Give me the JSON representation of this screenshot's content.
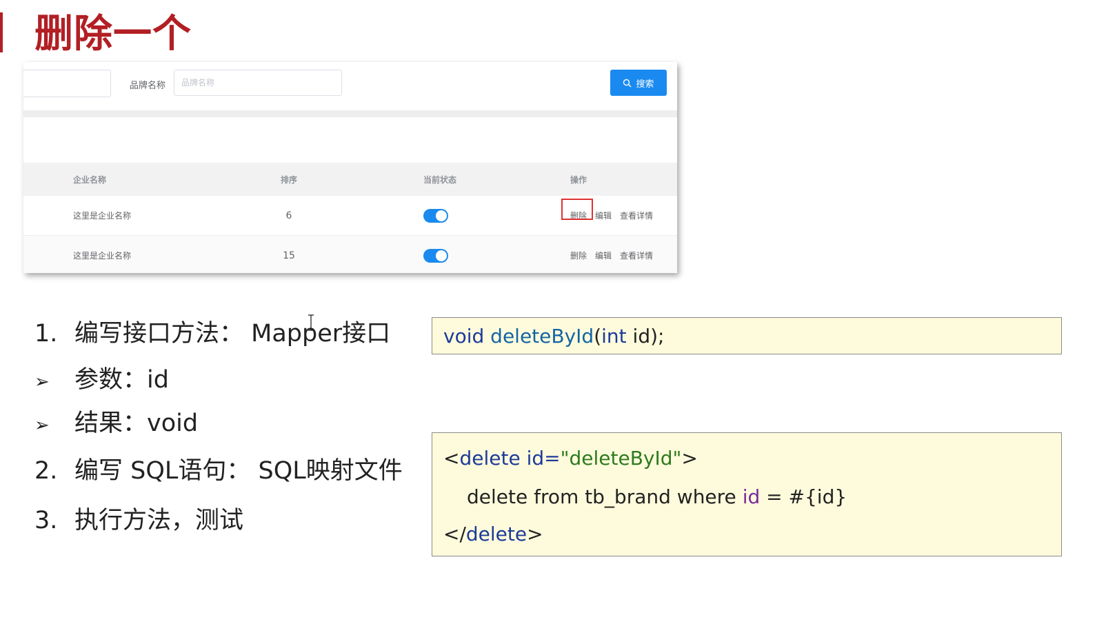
{
  "slide": {
    "title": "删除一个"
  },
  "app": {
    "search": {
      "brand_label": "品牌名称",
      "brand_placeholder": "品牌名称",
      "button_label": "搜索",
      "button_icon": "search-icon"
    },
    "table": {
      "headers": {
        "name": "企业名称",
        "sort": "排序",
        "status": "当前状态",
        "ops": "操作"
      },
      "rows": [
        {
          "name": "这里是企业名称",
          "sort": "6",
          "status_on": true,
          "ops": [
            "删除",
            "编辑",
            "查看详情"
          ],
          "delete_highlighted": true
        },
        {
          "name": "这里是企业名称",
          "sort": "15",
          "status_on": true,
          "ops": [
            "删除",
            "编辑",
            "查看详情"
          ],
          "delete_highlighted": false
        }
      ]
    }
  },
  "steps": [
    {
      "marker": "1.",
      "text": "编写接口方法：  Mapper接口"
    },
    {
      "marker": "➢",
      "text": "参数：id"
    },
    {
      "marker": "➢",
      "text": "结果：void"
    },
    {
      "marker": "2.",
      "text": "编写 SQL语句：  SQL映射文件"
    },
    {
      "marker": "3.",
      "text": "执行方法，测试"
    }
  ],
  "code1": {
    "void_kw": "void",
    "method": "deleteById",
    "open_paren": "(",
    "int_kw": "int",
    "rest": " id);"
  },
  "code2": {
    "line1": {
      "lt": "<",
      "tag": "delete",
      "attr": " id=",
      "value": "\"deleteById\"",
      "gt": ">"
    },
    "line2": {
      "text": "delete from tb_brand where ",
      "var": "id",
      "rest": " = #{id}"
    },
    "line3": {
      "lt": "</",
      "tag": "delete",
      "gt": ">"
    }
  },
  "colors": {
    "accent": "#b21f24",
    "primary": "#1a8af0",
    "code_bg": "#fdfbdc",
    "keyword": "#1d3a9a",
    "string": "#2f7a1f",
    "variable": "#7b2a9c"
  }
}
